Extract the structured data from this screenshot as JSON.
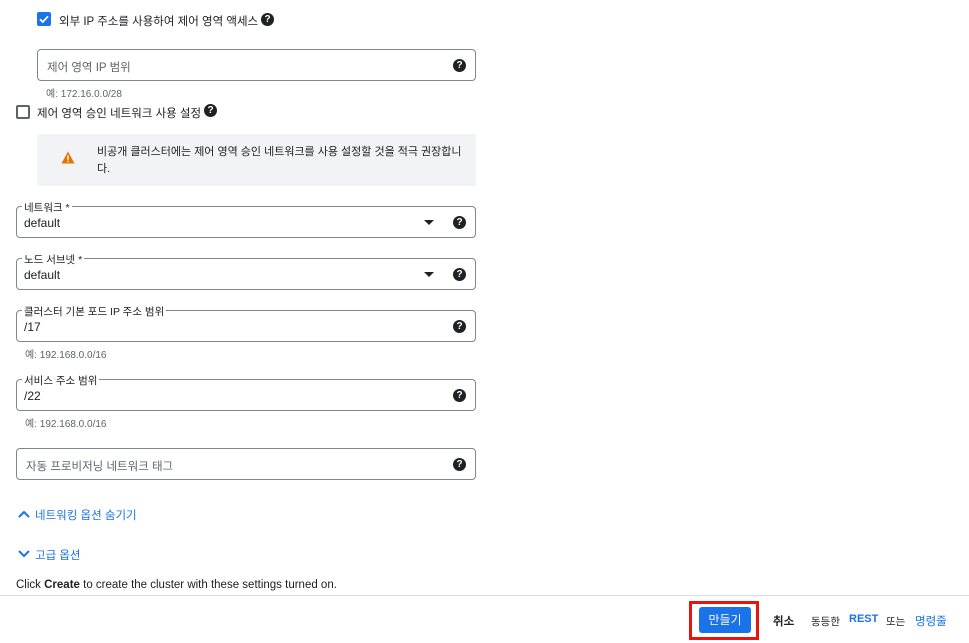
{
  "control_plane_external": {
    "label": "외부 IP 주소를 사용하여 제어 영역 액세스",
    "checked": true
  },
  "control_plane_ip_range": {
    "placeholder": "제어 영역 IP 범위",
    "hint": "예: 172.16.0.0/28"
  },
  "authorized_networks": {
    "label": "제어 영역 승인 네트워크 사용 설정",
    "checked": false,
    "warning": "비공개 클러스터에는 제어 영역 승인 네트워크를 사용 설정할 것을 적극 권장합니다."
  },
  "network": {
    "label": "네트워크 *",
    "value": "default"
  },
  "node_subnet": {
    "label": "노드 서브넷 *",
    "value": "default"
  },
  "pod_ip_range": {
    "label": "클러스터 기본 포드 IP 주소 범위",
    "value": "/17",
    "hint": "예: 192.168.0.0/16"
  },
  "service_range": {
    "label": "서비스 주소 범위",
    "value": "/22",
    "hint": "예: 192.168.0.0/16"
  },
  "network_tags": {
    "placeholder": "자동 프로비저닝 네트워크 태그"
  },
  "toggles": {
    "hide_networking": "네트워킹 옵션 숨기기",
    "advanced": "고급 옵션"
  },
  "info": {
    "prefix": "Click ",
    "bold": "Create",
    "suffix": " to create the cluster with these settings turned on."
  },
  "footer": {
    "create": "만들기",
    "cancel": "취소",
    "equivalent": "동등한",
    "rest": "REST",
    "or": "또는",
    "command_line": "명령줄"
  },
  "colors": {
    "accent": "#1a73e8",
    "warning": "#e37400",
    "highlight": "#e8140f"
  }
}
